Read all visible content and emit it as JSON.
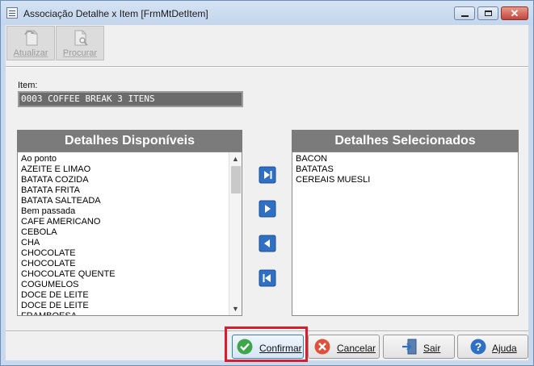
{
  "window": {
    "title": "Associação Detalhe x Item [FrmMtDetItem]",
    "controls": {
      "minimize": "—",
      "maximize": "□",
      "close": "✕"
    }
  },
  "toolbar": {
    "atualizar_label": "Atualizar",
    "procurar_label": "Procurar",
    "atualizar_icon": "document-refresh-icon",
    "procurar_icon": "document-search-icon"
  },
  "item": {
    "label": "Item:",
    "value": "0003  COFFEE BREAK 3 ITENS"
  },
  "available": {
    "header": "Detalhes Disponíveis",
    "items": [
      "Ao ponto",
      "AZEITE E LIMAO",
      "BATATA COZIDA",
      "BATATA FRITA",
      "BATATA SALTEADA",
      "Bem passada",
      "CAFE AMERICANO",
      "CEBOLA",
      "CHA",
      "CHOCOLATE",
      "CHOCOLATE",
      "CHOCOLATE QUENTE",
      "COGUMELOS",
      "DOCE DE LEITE",
      "DOCE DE LEITE",
      "FRAMBOESA"
    ]
  },
  "selected": {
    "header": "Detalhes Selecionados",
    "items": [
      "BACON",
      "BATATAS",
      "CEREAIS MUESLI"
    ]
  },
  "move_buttons": [
    "move-all-right-icon",
    "move-right-icon",
    "move-left-icon",
    "move-all-left-icon"
  ],
  "actions": {
    "confirmar_label": "Confirmar",
    "cancelar_label": "Cancelar",
    "sair_label": "Sair",
    "ajuda_label": "Ajuda"
  },
  "colors": {
    "highlight": "#d81e2a",
    "panel_header": "#7b7b7b",
    "arrow_blue": "#2f6fc4"
  }
}
